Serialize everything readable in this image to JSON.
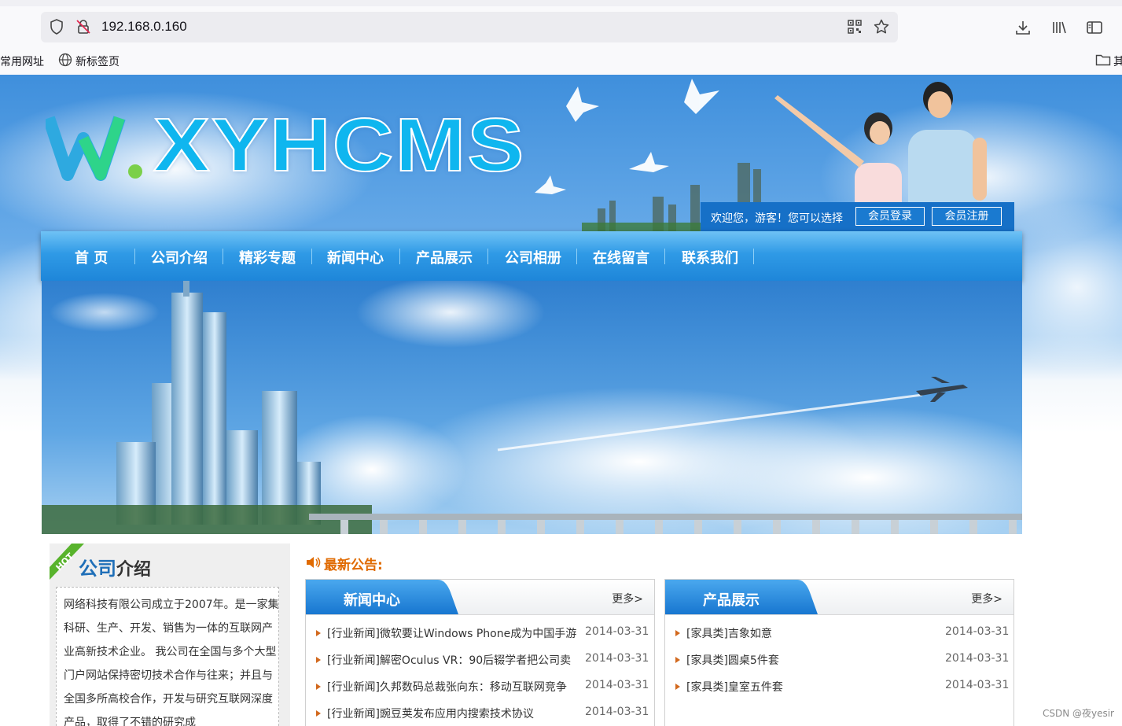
{
  "browser": {
    "url": "192.168.0.160",
    "bookmarks": [
      "常用网址",
      "新标签页",
      "其"
    ]
  },
  "site": {
    "logo_text": "XYHCMS",
    "welcome": {
      "text": "欢迎您，游客！您可以选择",
      "login": "会员登录",
      "register": "会员注册"
    },
    "nav": [
      "首 页",
      "公司介绍",
      "精彩专题",
      "新闻中心",
      "产品展示",
      "公司相册",
      "在线留言",
      "联系我们"
    ],
    "about": {
      "badge": "HOT",
      "title_highlight": "公司",
      "title_rest": "介绍",
      "text": "网络科技有限公司成立于2007年。是一家集科研、生产、开发、销售为一体的互联网产业高新技术企业。 我公司在全国与多个大型门户网站保持密切技术合作与往来；并且与全国多所高校合作，开发与研究互联网深度产品，取得了不错的研究成"
    },
    "notice_label": "最新公告:",
    "news": {
      "title": "新闻中心",
      "more": "更多>",
      "items": [
        {
          "title": "[行业新闻]微软要让Windows Phone成为中国手游",
          "date": "2014-03-31"
        },
        {
          "title": "[行业新闻]解密Oculus VR：90后辍学者把公司卖",
          "date": "2014-03-31"
        },
        {
          "title": "[行业新闻]久邦数码总裁张向东：移动互联网竞争",
          "date": "2014-03-31"
        },
        {
          "title": "[行业新闻]豌豆荚发布应用内搜索技术协议",
          "date": "2014-03-31"
        }
      ]
    },
    "products": {
      "title": "产品展示",
      "more": "更多>",
      "items": [
        {
          "title": "[家具类]吉象如意",
          "date": "2014-03-31"
        },
        {
          "title": "[家具类]圆桌5件套",
          "date": "2014-03-31"
        },
        {
          "title": "[家具类]皇室五件套",
          "date": "2014-03-31"
        }
      ]
    },
    "watermark": "CSDN @夜yesir"
  },
  "colors": {
    "nav_blue": "#2f9ae6",
    "header_blue": "#1670c7",
    "notice_orange": "#e06a00",
    "logo_cyan": "#0fb6ef"
  }
}
